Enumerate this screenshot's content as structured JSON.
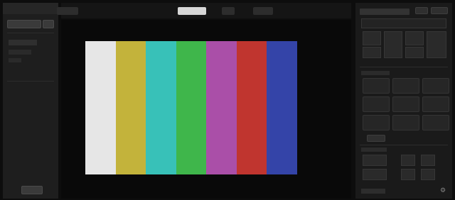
{
  "window": {
    "title": ""
  },
  "left_panel": {
    "buttons": [
      {
        "label": ""
      },
      {
        "label": ""
      },
      {
        "label": ""
      }
    ],
    "labels": [
      {
        "text": ""
      },
      {
        "text": ""
      },
      {
        "text": ""
      }
    ]
  },
  "top_bar": {
    "tabs": [
      {
        "label": ""
      },
      {
        "label": ""
      },
      {
        "label": ""
      }
    ],
    "active_tab_index": 0
  },
  "viewer": {
    "test_pattern": {
      "colors": [
        "#e6e6e6",
        "#c3b33b",
        "#38c1b8",
        "#3fb64b",
        "#aa4fa8",
        "#c0352f",
        "#3444a8"
      ]
    }
  },
  "right_panel": {
    "section_titles": [
      {
        "text": ""
      },
      {
        "text": ""
      },
      {
        "text": ""
      }
    ],
    "presets": [
      {
        "label": ""
      },
      {
        "label": ""
      },
      {
        "label": ""
      },
      {
        "label": ""
      },
      {
        "label": ""
      },
      {
        "label": ""
      },
      {
        "label": ""
      },
      {
        "label": ""
      },
      {
        "label": ""
      }
    ],
    "footer_label": ""
  },
  "colors": {
    "background": "#0d0d0d",
    "panel": "#1e1e1e",
    "active_tab": "#d7d7d7"
  },
  "icons": [
    "settings-icon",
    "menu-icon"
  ]
}
